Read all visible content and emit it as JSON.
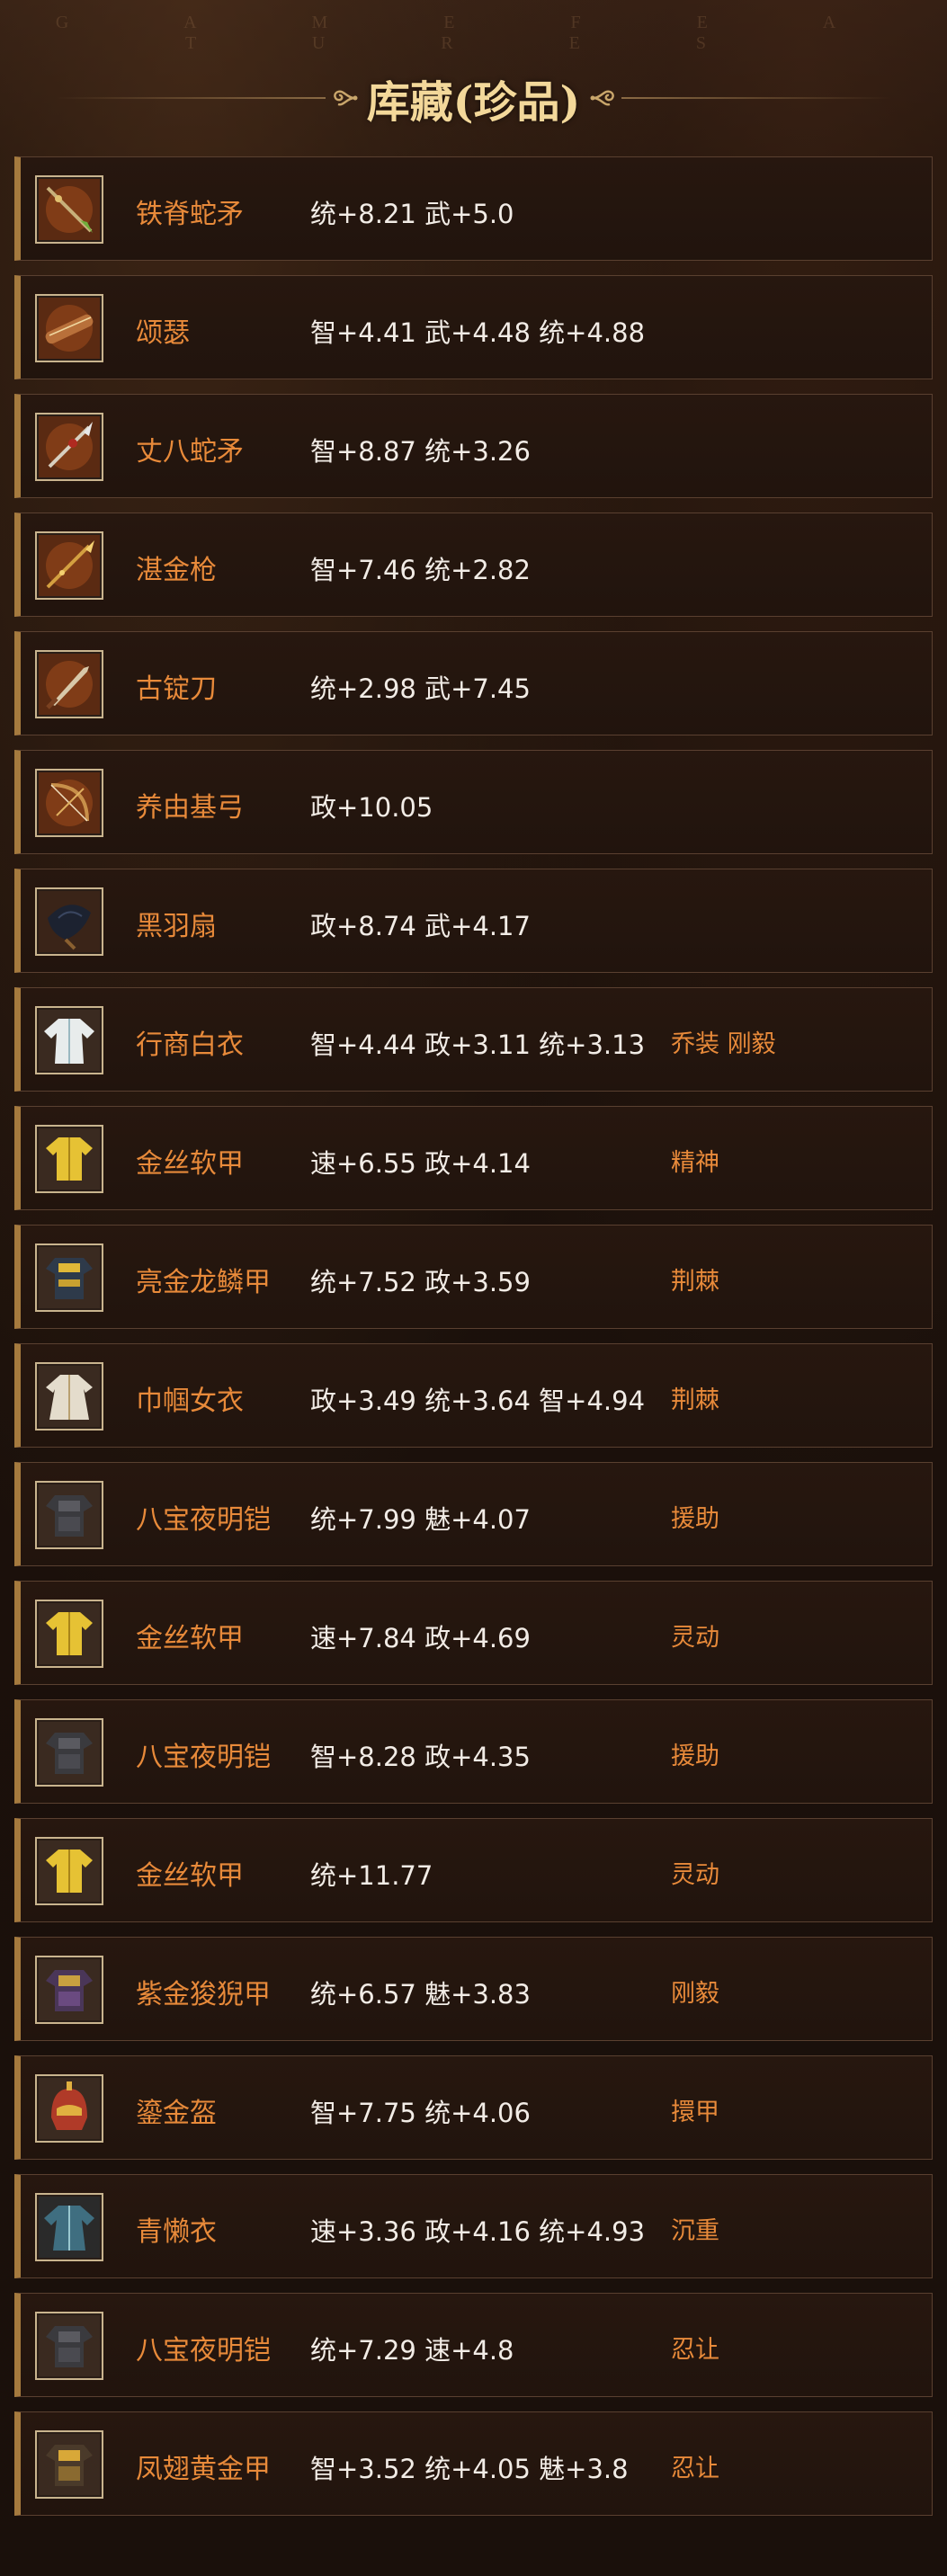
{
  "watermark": "G A M E   F E A T U R E S",
  "title": "库藏(珍品)",
  "colors": {
    "name": "#e88a3a",
    "stats": "#f2ece6",
    "title": "#f3d89a",
    "accent": "#a57a3e"
  },
  "items": [
    {
      "name": "铁脊蛇矛",
      "stats": "统+8.21 武+5.0",
      "traits": "",
      "icon": "spear-icon"
    },
    {
      "name": "颂瑟",
      "stats": "智+4.41 武+4.48 统+4.88",
      "traits": "",
      "icon": "zither-icon"
    },
    {
      "name": "丈八蛇矛",
      "stats": "智+8.87 统+3.26",
      "traits": "",
      "icon": "serpent-spear-icon"
    },
    {
      "name": "湛金枪",
      "stats": "智+7.46 统+2.82",
      "traits": "",
      "icon": "gold-spear-icon"
    },
    {
      "name": "古锭刀",
      "stats": "统+2.98 武+7.45",
      "traits": "",
      "icon": "blade-icon"
    },
    {
      "name": "养由基弓",
      "stats": "政+10.05",
      "traits": "",
      "icon": "bow-icon"
    },
    {
      "name": "黑羽扇",
      "stats": "政+8.74 武+4.17",
      "traits": "",
      "icon": "feather-fan-icon"
    },
    {
      "name": "行商白衣",
      "stats": "智+4.44 政+3.11 统+3.13",
      "traits": "乔装 刚毅",
      "icon": "white-robe-icon"
    },
    {
      "name": "金丝软甲",
      "stats": "速+6.55 政+4.14",
      "traits": "精神",
      "icon": "golden-vest-icon"
    },
    {
      "name": "亮金龙鳞甲",
      "stats": "统+7.52 政+3.59",
      "traits": "荆棘",
      "icon": "dragon-armor-icon"
    },
    {
      "name": "巾帼女衣",
      "stats": "政+3.49 统+3.64 智+4.94",
      "traits": "荆棘",
      "icon": "lady-robe-icon"
    },
    {
      "name": "八宝夜明铠",
      "stats": "统+7.99 魅+4.07",
      "traits": "援助",
      "icon": "dark-armor-icon"
    },
    {
      "name": "金丝软甲",
      "stats": "速+7.84 政+4.69",
      "traits": "灵动",
      "icon": "golden-vest-icon"
    },
    {
      "name": "八宝夜明铠",
      "stats": "智+8.28 政+4.35",
      "traits": "援助",
      "icon": "dark-armor-icon"
    },
    {
      "name": "金丝软甲",
      "stats": "统+11.77",
      "traits": "灵动",
      "icon": "golden-vest-icon"
    },
    {
      "name": "紫金狻猊甲",
      "stats": "统+6.57 魅+3.83",
      "traits": "刚毅",
      "icon": "purple-armor-icon"
    },
    {
      "name": "鎏金盔",
      "stats": "智+7.75 统+4.06",
      "traits": "擐甲",
      "icon": "helmet-icon"
    },
    {
      "name": "青懒衣",
      "stats": "速+3.36 政+4.16 统+4.93",
      "traits": "沉重",
      "icon": "blue-robe-icon"
    },
    {
      "name": "八宝夜明铠",
      "stats": "统+7.29 速+4.8",
      "traits": "忍让",
      "icon": "dark-armor-icon"
    },
    {
      "name": "凤翅黄金甲",
      "stats": "智+3.52 统+4.05 魅+3.8",
      "traits": "忍让",
      "icon": "phoenix-armor-icon"
    }
  ]
}
